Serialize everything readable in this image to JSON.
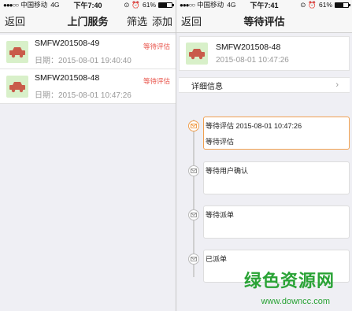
{
  "left": {
    "status": {
      "signal": "●●●○○",
      "carrier": "中国移动",
      "network": "4G",
      "time": "下午7:40",
      "battery": "61%",
      "battery_level": 0.61
    },
    "nav": {
      "back": "返回",
      "title": "上门服务",
      "filter": "筛选",
      "add": "添加"
    },
    "orders": [
      {
        "code": "SMFW201508-49",
        "date": "日期：2015-08-01 19:40:40",
        "status": "等待评估"
      },
      {
        "code": "SMFW201508-48",
        "date": "日期：2015-08-01 10:47:26",
        "status": "等待评估"
      }
    ]
  },
  "right": {
    "status": {
      "signal": "●●●○○",
      "carrier": "中国移动",
      "network": "4G",
      "time": "下午7:41",
      "battery": "61%",
      "battery_level": 0.61
    },
    "nav": {
      "back": "返回",
      "title": "等待评估"
    },
    "order": {
      "code": "SMFW201508-48",
      "date": "2015-08-01 10:47:26"
    },
    "detail": {
      "label": "详细信息",
      "chevron": "›"
    },
    "timeline": [
      {
        "title": "等待评估 2015-08-01 10:47:26",
        "sub": "等待评估"
      },
      {
        "title": "等待用户确认",
        "sub": ""
      },
      {
        "title": "等待派单",
        "sub": ""
      },
      {
        "title": "已派单",
        "sub": ""
      }
    ]
  },
  "watermark": {
    "text": "绿色资源网",
    "url": "www.downcc.com"
  },
  "colors": {
    "accent": "#e8534a",
    "timeline_active": "#f0a050",
    "thumb_bg": "#d8f0c9",
    "watermark": "#2aa336"
  }
}
